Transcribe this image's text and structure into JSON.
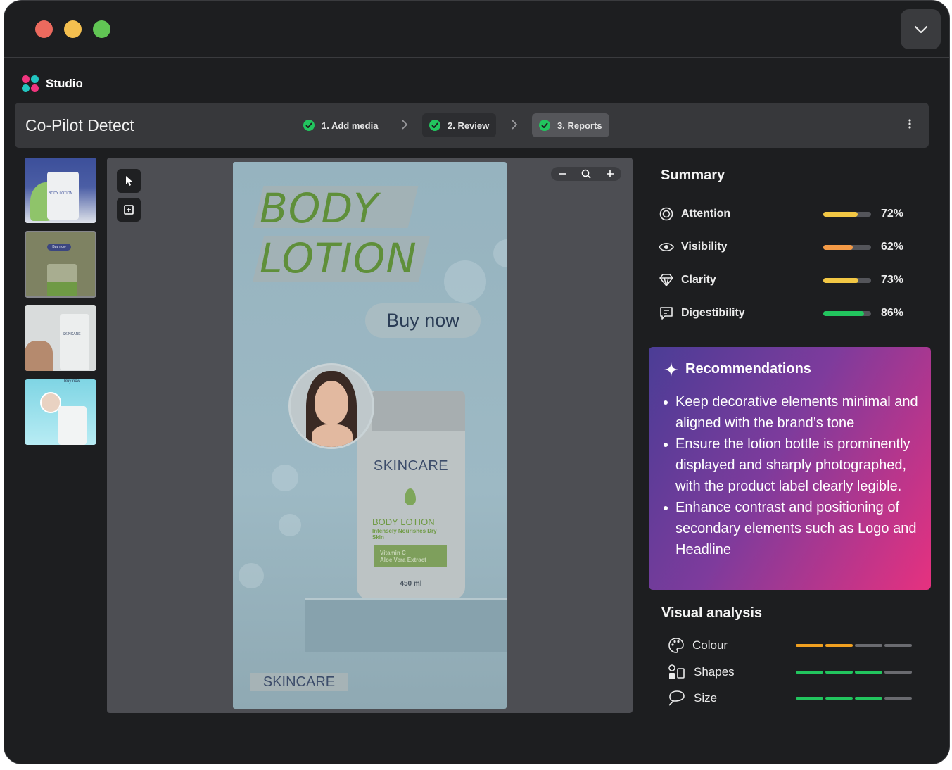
{
  "app": {
    "brand_name": "Studio",
    "page_title": "Co-Pilot Detect"
  },
  "steps": [
    {
      "label": "1. Add media",
      "done": true
    },
    {
      "label": "2. Review",
      "done": true
    },
    {
      "label": "3. Reports",
      "done": true,
      "active": true
    }
  ],
  "thumbnails": [
    {
      "name": "thumb-aloe-blue",
      "caption": "BODY LOTION"
    },
    {
      "name": "thumb-buy-now-green",
      "caption": "Buy now"
    },
    {
      "name": "thumb-model-skincare",
      "caption": "SKINCARE"
    },
    {
      "name": "thumb-bubble-skincare",
      "caption": "Buy now"
    }
  ],
  "ad_preview": {
    "headline_line1": "BODY",
    "headline_line2": "LOTION",
    "cta": "Buy now",
    "bottle_brand": "SKINCARE",
    "bottle_product": "BODY LOTION",
    "bottle_tagline": "Intensely Nourishes Dry Skin",
    "bottle_ingredient1": "Vitamin C",
    "bottle_ingredient2": "Aloe Vera Extract",
    "bottle_volume": "450 ml",
    "logo": "SKINCARE"
  },
  "summary": {
    "title": "Summary",
    "metrics": [
      {
        "label": "Attention",
        "value": "72%",
        "fraction": 0.72,
        "color": "#f2c744",
        "icon": "target-icon"
      },
      {
        "label": "Visibility",
        "value": "62%",
        "fraction": 0.62,
        "color": "#f49a46",
        "icon": "eye-icon"
      },
      {
        "label": "Clarity",
        "value": "73%",
        "fraction": 0.73,
        "color": "#f2c744",
        "icon": "diamond-icon"
      },
      {
        "label": "Digestibility",
        "value": "86%",
        "fraction": 0.86,
        "color": "#22c55e",
        "icon": "message-icon"
      }
    ]
  },
  "recommendations": {
    "title": "Recommendations",
    "items": [
      "Keep decorative elements minimal and aligned with the brand’s tone",
      "Ensure the lotion bottle is prominently displayed and sharply photographed, with the product label clearly legible.",
      "Enhance contrast and positioning of secondary elements such as Logo and Headline"
    ]
  },
  "visual_analysis": {
    "title": "Visual analysis",
    "items": [
      {
        "label": "Colour",
        "level": 2,
        "of": 4,
        "color": "#f0a020",
        "icon": "palette-icon"
      },
      {
        "label": "Shapes",
        "level": 3,
        "of": 4,
        "color": "#22c55e",
        "icon": "shapes-icon"
      },
      {
        "label": "Size",
        "level": 3,
        "of": 4,
        "color": "#22c55e",
        "icon": "lasso-icon"
      }
    ]
  }
}
